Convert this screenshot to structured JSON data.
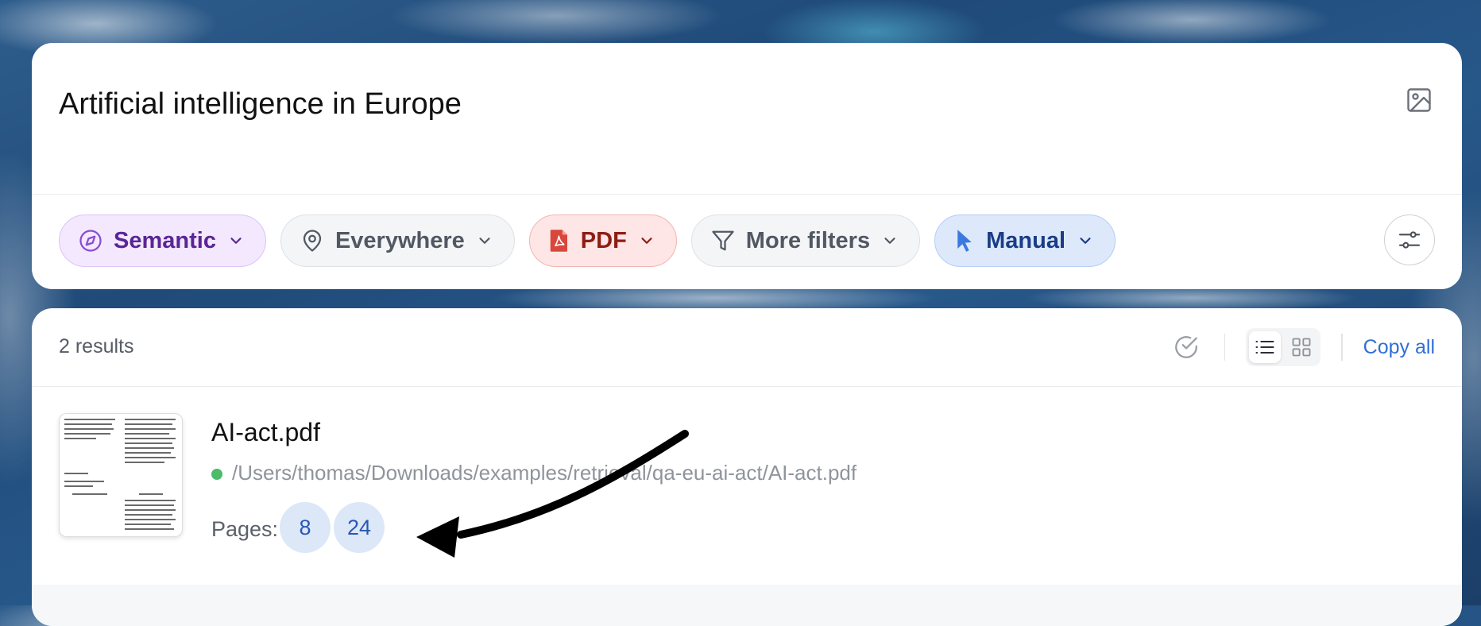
{
  "search": {
    "query": "Artificial intelligence in Europe",
    "image_button_icon": "image-icon"
  },
  "filters": [
    {
      "label": "Semantic",
      "icon": "compass-icon",
      "color": "#5a2596"
    },
    {
      "label": "Everywhere",
      "icon": "location-pin-icon",
      "color": "#515863"
    },
    {
      "label": "PDF",
      "icon": "pdf-file-icon",
      "color": "#8e1d14"
    },
    {
      "label": "More filters",
      "icon": "funnel-icon",
      "color": "#515863"
    },
    {
      "label": "Manual",
      "icon": "cursor-icon",
      "color": "#1a3d86"
    }
  ],
  "settings_icon": "sliders-icon",
  "results": {
    "count_label": "2 results",
    "copy_all_label": "Copy all",
    "active_view": "list",
    "items": [
      {
        "file_name": "AI-act.pdf",
        "path": "/Users/thomas/Downloads/examples/retrieval/qa-eu-ai-act/AI-act.pdf",
        "status_color": "#4cbb6a",
        "pages_label": "Pages:",
        "pages": [
          "8",
          "24"
        ]
      }
    ]
  }
}
